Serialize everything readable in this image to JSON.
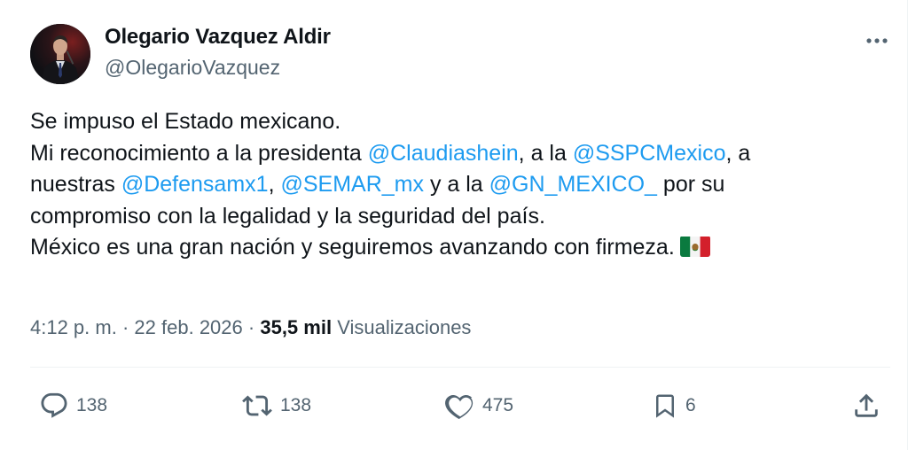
{
  "author": {
    "display_name": "Olegario Vazquez Aldir",
    "handle": "@OlegarioVazquez",
    "avatar_icon": "profile-photo"
  },
  "more_icon": "more-horizontal-icon",
  "tweet": {
    "line1": "Se impuso el Estado mexicano.",
    "line2_pre": "Mi reconocimiento a la presidenta ",
    "mention1": "@Claudiashein",
    "line2_mid": ", a la ",
    "mention2": "@SSPCMexico",
    "line2_post": ", a",
    "line3_pre": "nuestras ",
    "mention3": "@Defensamx1",
    "line3_mid1": ", ",
    "mention4": "@SEMAR_mx",
    "line3_mid2": " y a la ",
    "mention5": "@GN_MEXICO_",
    "line3_post": " por su",
    "line4": "compromiso con la legalidad y la seguridad del país.",
    "line5": "México es una gran nación y seguiremos avanzando con firmeza.",
    "flag_icon": "mexico-flag-emoji"
  },
  "meta": {
    "time": "4:12 p. m.",
    "separator": "·",
    "date": "22 feb. 2026",
    "views_count": "35,5 mil",
    "views_label": "Visualizaciones"
  },
  "actions": {
    "replies": "138",
    "reposts": "138",
    "likes": "475",
    "bookmarks": "6"
  },
  "colors": {
    "link": "#1d9bf0",
    "secondary_text": "#536471",
    "primary_text": "#0f1419",
    "divider": "#eff3f4"
  }
}
